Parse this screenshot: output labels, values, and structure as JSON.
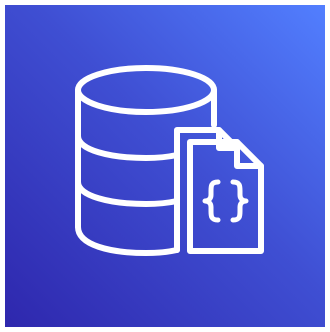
{
  "icon": {
    "name": "database-document-icon",
    "gradient_start": "#2e27ad",
    "gradient_end": "#527fff",
    "stroke_color": "#ffffff"
  }
}
